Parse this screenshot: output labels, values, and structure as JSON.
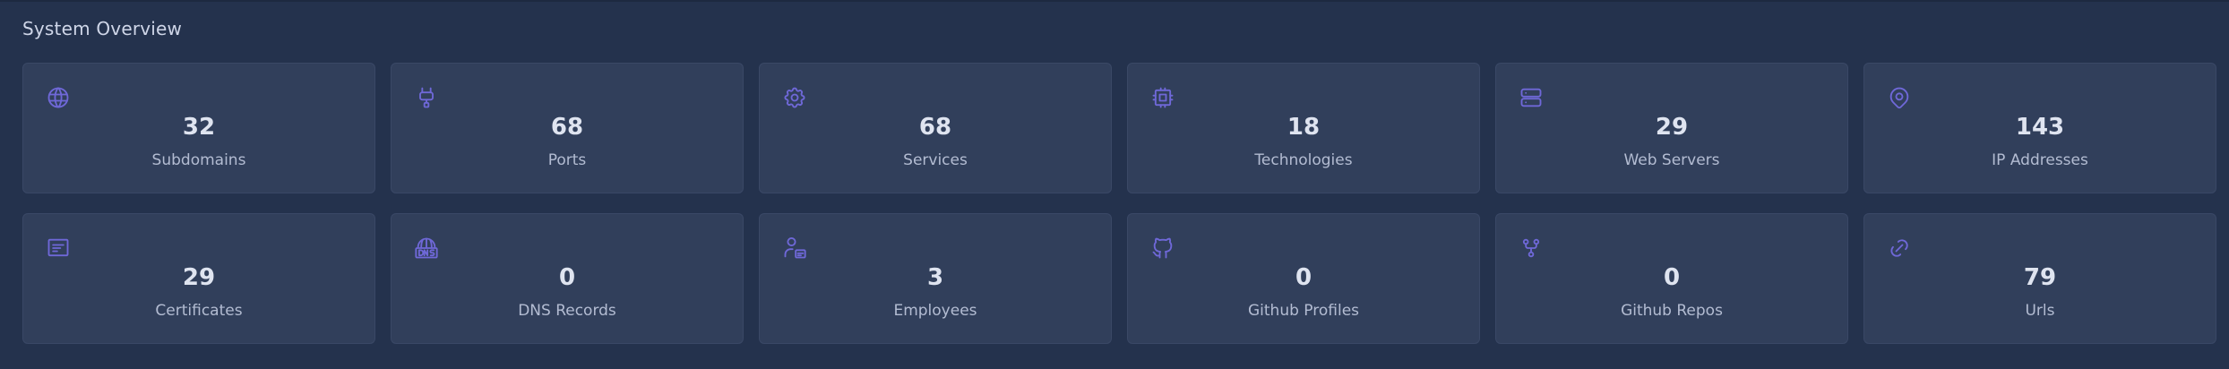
{
  "section": {
    "title": "System Overview"
  },
  "cards": [
    {
      "icon": "globe-icon",
      "count": "32",
      "label": "Subdomains"
    },
    {
      "icon": "plug-icon",
      "count": "68",
      "label": "Ports"
    },
    {
      "icon": "gear-icon",
      "count": "68",
      "label": "Services"
    },
    {
      "icon": "cpu-icon",
      "count": "18",
      "label": "Technologies"
    },
    {
      "icon": "server-icon",
      "count": "29",
      "label": "Web Servers"
    },
    {
      "icon": "map-pin-icon",
      "count": "143",
      "label": "IP Addresses"
    },
    {
      "icon": "certificate-icon",
      "count": "29",
      "label": "Certificates"
    },
    {
      "icon": "dns-icon",
      "count": "0",
      "label": "DNS Records"
    },
    {
      "icon": "user-badge-icon",
      "count": "3",
      "label": "Employees"
    },
    {
      "icon": "github-icon",
      "count": "0",
      "label": "Github Profiles"
    },
    {
      "icon": "git-fork-icon",
      "count": "0",
      "label": "Github Repos"
    },
    {
      "icon": "link-icon",
      "count": "79",
      "label": "Urls"
    }
  ],
  "colors": {
    "background": "#24324d",
    "card": "#313f5b",
    "accent": "#6f68d8"
  }
}
